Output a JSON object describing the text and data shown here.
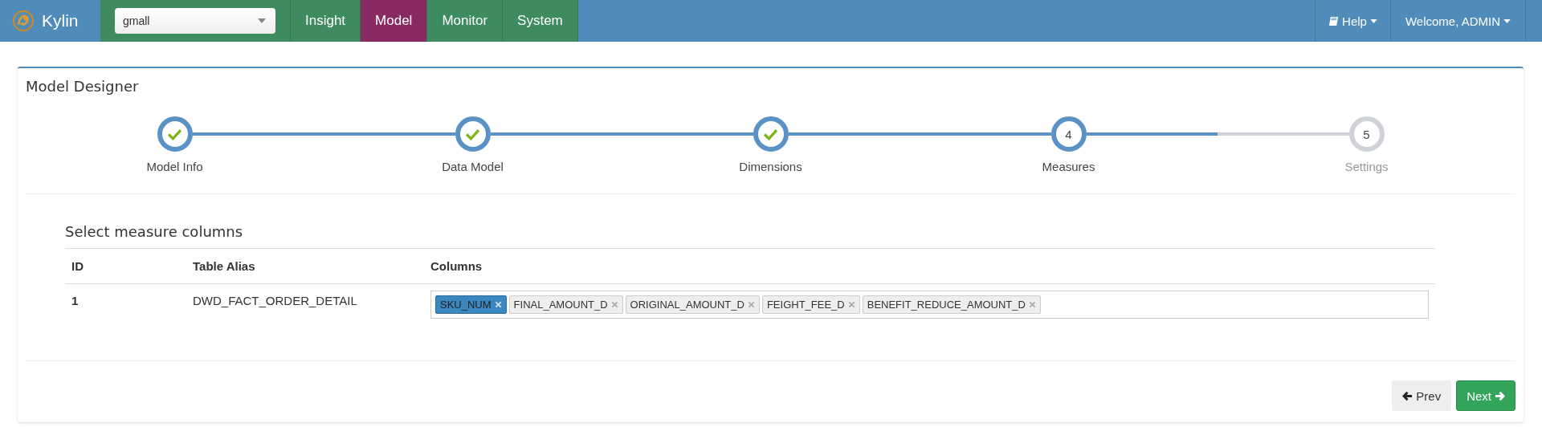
{
  "navbar": {
    "brand": "Kylin",
    "project_select": {
      "value": "gmall"
    },
    "tabs": [
      {
        "label": "Insight",
        "selected": false
      },
      {
        "label": "Model",
        "selected": true
      },
      {
        "label": "Monitor",
        "selected": false
      },
      {
        "label": "System",
        "selected": false
      }
    ],
    "help_menu": "Help",
    "user_menu": "Welcome, ADMIN"
  },
  "panel": {
    "title": "Model Designer",
    "steps": [
      {
        "label": "Model Info",
        "kind": "done"
      },
      {
        "label": "Data Model",
        "kind": "done"
      },
      {
        "label": "Dimensions",
        "kind": "done"
      },
      {
        "label": "Measures",
        "number": "4",
        "kind": "current"
      },
      {
        "label": "Settings",
        "number": "5",
        "kind": "pending"
      }
    ],
    "section_title": "Select measure columns",
    "table": {
      "columns": [
        "ID",
        "Table Alias",
        "Columns"
      ],
      "rows": [
        {
          "cells": [
            "1",
            "DWD_FACT_ORDER_DETAIL"
          ],
          "tags": [
            {
              "label": "SKU_NUM",
              "selected": true
            },
            {
              "label": "FINAL_AMOUNT_D",
              "selected": false
            },
            {
              "label": "ORIGINAL_AMOUNT_D",
              "selected": false
            },
            {
              "label": "FEIGHT_FEE_D",
              "selected": false
            },
            {
              "label": "BENEFIT_REDUCE_AMOUNT_D",
              "selected": false
            }
          ]
        }
      ]
    },
    "buttons": {
      "prev": "Prev",
      "next": "Next"
    }
  }
}
